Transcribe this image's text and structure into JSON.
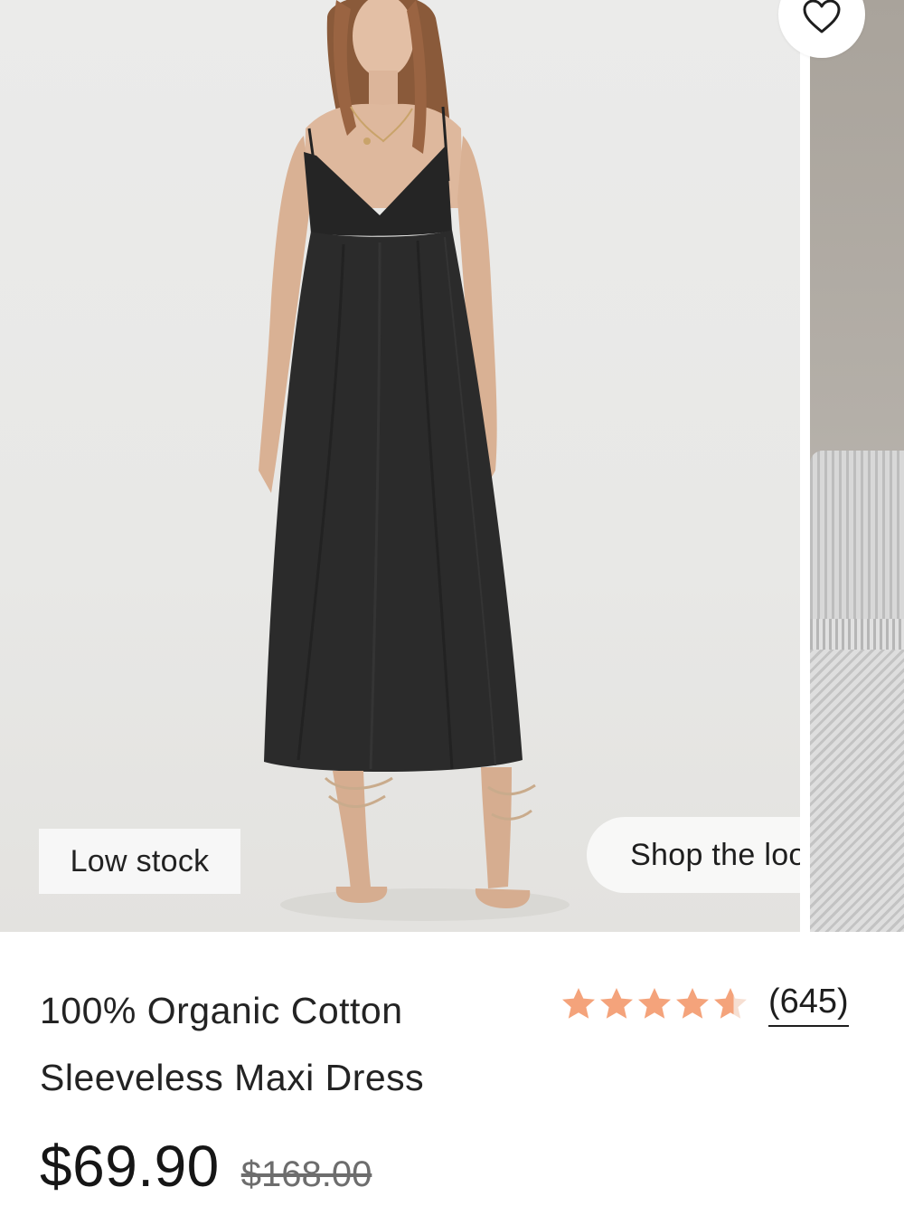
{
  "badges": {
    "stock": "Low stock",
    "shop_look": "Shop the look"
  },
  "product": {
    "title_line1": "100% Organic Cotton",
    "title_line2": "Sleeveless Maxi Dress",
    "rating": 4.6,
    "max_rating": 5,
    "review_count": "(645)",
    "price_current": "$69.90",
    "price_original": "$168.00"
  },
  "icons": {
    "wishlist": "heart-icon",
    "rating": "star-icon"
  },
  "colors": {
    "star_fill": "#f4a37b",
    "star_empty": "#f6dfd2",
    "text": "#1c1c1c",
    "strike_price": "#6d6d6d"
  }
}
